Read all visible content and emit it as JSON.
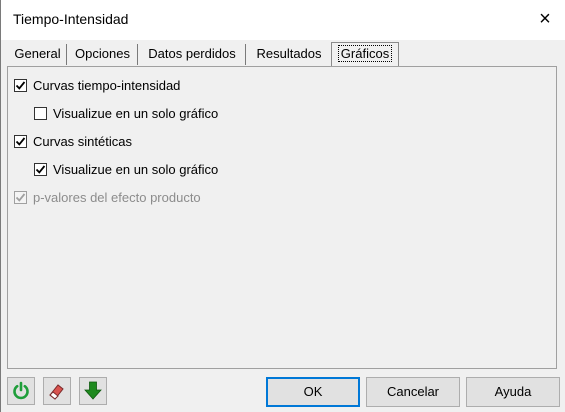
{
  "window": {
    "title": "Tiempo-Intensidad",
    "close_icon": "×"
  },
  "tabs": [
    {
      "label": "General",
      "active": false
    },
    {
      "label": "Opciones",
      "active": false
    },
    {
      "label": "Datos perdidos",
      "active": false
    },
    {
      "label": "Resultados",
      "active": false
    },
    {
      "label": "Gráficos",
      "active": true
    }
  ],
  "options": [
    {
      "label": "Curvas tiempo-intensidad",
      "checked": true,
      "enabled": true,
      "indent": 0
    },
    {
      "label": "Visualizue en un solo gráfico",
      "checked": false,
      "enabled": true,
      "indent": 1
    },
    {
      "label": "Curvas sintéticas",
      "checked": true,
      "enabled": true,
      "indent": 0
    },
    {
      "label": "Visualizue en un solo gráfico",
      "checked": true,
      "enabled": true,
      "indent": 1
    },
    {
      "label": "p-valores del efecto producto",
      "checked": true,
      "enabled": false,
      "indent": 0
    }
  ],
  "toolbar": {
    "icons": [
      "reset-icon",
      "eraser-icon",
      "arrow-down-icon"
    ],
    "colors": {
      "reset": "#1e9e3a",
      "arrow": "#1f8a1f",
      "eraser": "#d9534f"
    }
  },
  "buttons": {
    "ok": "OK",
    "cancel": "Cancelar",
    "help": "Ayuda"
  }
}
